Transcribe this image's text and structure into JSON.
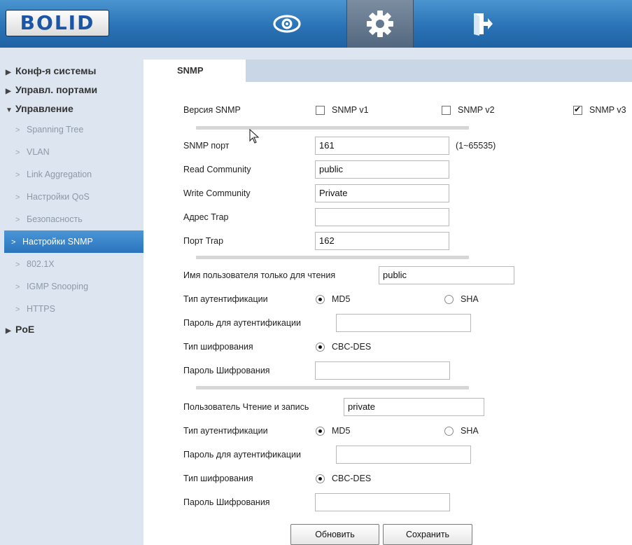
{
  "header": {
    "logo": "BOLID",
    "buttons": [
      {
        "icon": "eye-icon"
      },
      {
        "icon": "gear-icon",
        "active": true
      },
      {
        "icon": "exit-door-icon"
      }
    ]
  },
  "sidebar": {
    "groups": {
      "system": "Конф-я системы",
      "ports": "Управл. портами",
      "management": "Управление",
      "poe": "PoE"
    },
    "items": [
      "Spanning Tree",
      "VLAN",
      "Link Aggregation",
      "Настройки QoS",
      "Безопасность",
      "Настройки SNMP",
      "802.1X",
      "IGMP Snooping",
      "HTTPS"
    ],
    "active_item": "Настройки SNMP"
  },
  "tab": "SNMP",
  "form": {
    "version_label": "Версия SNMP",
    "v1": {
      "label": "SNMP v1",
      "checked": false
    },
    "v2": {
      "label": "SNMP v2",
      "checked": false
    },
    "v3": {
      "label": "SNMP v3",
      "checked": true
    },
    "port_label": "SNMP порт",
    "port_value": "161",
    "port_range": "(1~65535)",
    "read_community_label": "Read Community",
    "read_community_value": "public",
    "write_community_label": "Write Community",
    "write_community_value": "Private",
    "trap_address_label": "Адрес Trap",
    "trap_address_value": "",
    "trap_port_label": "Порт Trap",
    "trap_port_value": "162",
    "ro_user": {
      "user_label": "Имя пользователя только для чтения",
      "user_value": "public",
      "auth_type_label": "Тип аутентификации",
      "md5_label": "MD5",
      "sha_label": "SHA",
      "auth_selected": "MD5",
      "auth_password_label": "Пароль для аутентификации",
      "auth_password_value": "",
      "encryption_label": "Тип шифрования",
      "encryption_option": "CBC-DES",
      "encryption_password_label": "Пароль Шифрования",
      "encryption_password_value": ""
    },
    "rw_user": {
      "user_label": "Пользователь Чтение и запись",
      "user_value": "private",
      "auth_type_label": "Тип аутентификации",
      "md5_label": "MD5",
      "sha_label": "SHA",
      "auth_selected": "MD5",
      "auth_password_label": "Пароль для аутентификации",
      "auth_password_value": "",
      "encryption_label": "Тип шифрования",
      "encryption_option": "CBC-DES",
      "encryption_password_label": "Пароль Шифрования",
      "encryption_password_value": ""
    },
    "refresh_button": "Обновить",
    "save_button": "Сохранить"
  }
}
